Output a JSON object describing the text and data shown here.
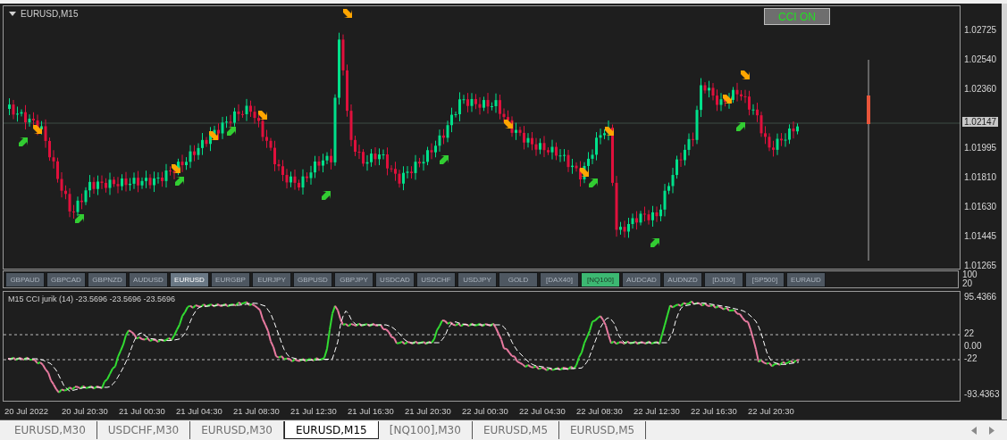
{
  "chart_title": "EURUSD,M15",
  "cci_button": {
    "label": "CCI ON",
    "on": true
  },
  "price_axis": [
    "1.02725",
    "1.02540",
    "1.02360",
    "1.01995",
    "1.01810",
    "1.01630",
    "1.01445",
    "1.01265"
  ],
  "current_price": "1.02147",
  "symbols": [
    {
      "label": "GBPAUD",
      "selected": false,
      "highlighted": false
    },
    {
      "label": "GBPCAD",
      "selected": false,
      "highlighted": false
    },
    {
      "label": "GBPNZD",
      "selected": false,
      "highlighted": false
    },
    {
      "label": "AUDUSD",
      "selected": false,
      "highlighted": false
    },
    {
      "label": "EURUSD",
      "selected": true,
      "highlighted": false
    },
    {
      "label": "EURGBP",
      "selected": false,
      "highlighted": false
    },
    {
      "label": "EURJPY",
      "selected": false,
      "highlighted": false
    },
    {
      "label": "GBPUSD",
      "selected": false,
      "highlighted": false
    },
    {
      "label": "GBPJPY",
      "selected": false,
      "highlighted": false
    },
    {
      "label": "USDCAD",
      "selected": false,
      "highlighted": false
    },
    {
      "label": "USDCHF",
      "selected": false,
      "highlighted": false
    },
    {
      "label": "USDJPY",
      "selected": false,
      "highlighted": false
    },
    {
      "label": "GOLD",
      "selected": false,
      "highlighted": false
    },
    {
      "label": "[DAX40]",
      "selected": false,
      "highlighted": false
    },
    {
      "label": "[NQ100]",
      "selected": false,
      "highlighted": true
    },
    {
      "label": "AUDCAD",
      "selected": false,
      "highlighted": false
    },
    {
      "label": "AUDNZD",
      "selected": false,
      "highlighted": false
    },
    {
      "label": "[DJI30]",
      "selected": false,
      "highlighted": false
    },
    {
      "label": "[SP500]",
      "selected": false,
      "highlighted": false
    },
    {
      "label": "EURAUD",
      "selected": false,
      "highlighted": false
    }
  ],
  "symbol_axis": [
    "100",
    "20"
  ],
  "indicator": {
    "title": "M15  CCI jurik (14) -23.5696 -23.5696 -23.5696",
    "axis": [
      {
        "label": "95.4366"
      },
      {
        "label": "22"
      },
      {
        "label": "0.00"
      },
      {
        "label": "-22"
      },
      {
        "label": "-93.4363"
      }
    ]
  },
  "time_axis": [
    "20 Jul 2022",
    "20 Jul 20:30",
    "21 Jul 00:30",
    "21 Jul 04:30",
    "21 Jul 08:30",
    "21 Jul 12:30",
    "21 Jul 16:30",
    "21 Jul 20:30",
    "22 Jul 00:30",
    "22 Jul 04:30",
    "22 Jul 08:30",
    "22 Jul 12:30",
    "22 Jul 16:30",
    "22 Jul 20:30"
  ],
  "tabs": [
    {
      "label": "EURUSD,M30",
      "selected": false
    },
    {
      "label": "USDCHF,M30",
      "selected": false
    },
    {
      "label": "EURUSD,M30",
      "selected": false
    },
    {
      "label": "EURUSD,M15",
      "selected": true
    },
    {
      "label": "[NQ100],M30",
      "selected": false
    },
    {
      "label": "EURUSD,M5",
      "selected": false
    },
    {
      "label": "EURUSD,M5",
      "selected": false
    }
  ]
}
